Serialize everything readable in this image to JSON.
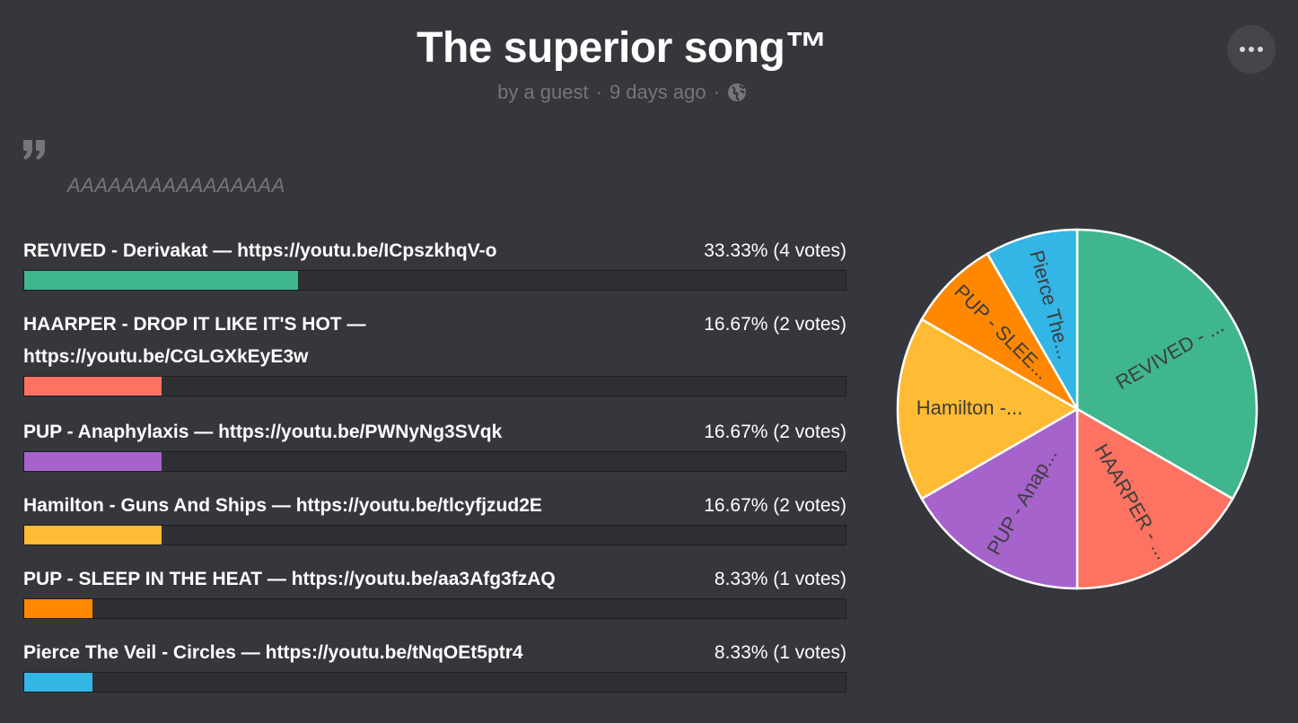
{
  "poll": {
    "title": "The superior song™",
    "author": "by a guest",
    "separator": "·",
    "time_ago": "9 days ago",
    "description": "AAAAAAAAAAAAAAAA"
  },
  "options": [
    {
      "label": "REVIVED - Derivakat — https://youtu.be/ICpszkhqV-o",
      "result": "33.33% (4 votes)",
      "percent": 33.33,
      "votes": 4,
      "color": "#3fb68d",
      "pie_label": "REVIVED - ..."
    },
    {
      "label": "HAARPER - DROP IT LIKE IT'S HOT — https://youtu.be/CGLGXkEyE3w",
      "result": "16.67% (2 votes)",
      "percent": 16.67,
      "votes": 2,
      "color": "#fd7261",
      "pie_label": "HAARPER - ..."
    },
    {
      "label": "PUP - Anaphylaxis — https://youtu.be/PWNyNg3SVqk",
      "result": "16.67% (2 votes)",
      "percent": 16.67,
      "votes": 2,
      "color": "#a663cc",
      "pie_label": "PUP - Anap..."
    },
    {
      "label": "Hamilton - Guns And Ships — https://youtu.be/tlcyfjzud2E",
      "result": "16.67% (2 votes)",
      "percent": 16.67,
      "votes": 2,
      "color": "#ffbb33",
      "pie_label": "Hamilton -..."
    },
    {
      "label": "PUP - SLEEP IN THE HEAT — https://youtu.be/aa3Afg3fzAQ",
      "result": "8.33% (1 votes)",
      "percent": 8.33,
      "votes": 1,
      "color": "#ff8800",
      "pie_label": "PUP - SLEE..."
    },
    {
      "label": "Pierce The Veil - Circles — https://youtu.be/tNqOEt5ptr4",
      "result": "8.33% (1 votes)",
      "percent": 8.33,
      "votes": 1,
      "color": "#33b5e5",
      "pie_label": "Pierce The..."
    }
  ],
  "icons": {
    "globe": "globe-icon",
    "quote": "quote-icon",
    "menu": "more-options-icon"
  },
  "chart_data": {
    "type": "pie",
    "categories": [
      "REVIVED - ...",
      "HAARPER - ...",
      "PUP - Anap...",
      "Hamilton -...",
      "PUP - SLEE...",
      "Pierce The..."
    ],
    "values": [
      4,
      2,
      2,
      2,
      1,
      1
    ],
    "colors": [
      "#3fb68d",
      "#fd7261",
      "#a663cc",
      "#ffbb33",
      "#ff8800",
      "#33b5e5"
    ]
  }
}
